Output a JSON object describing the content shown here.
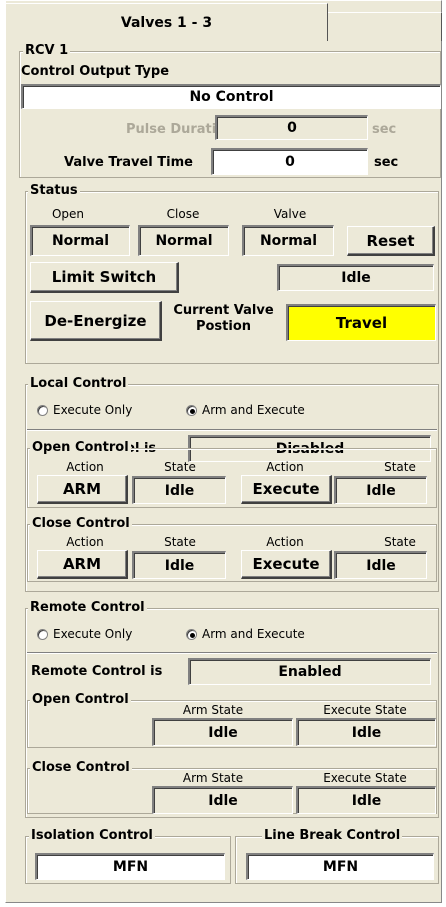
{
  "tabs": {
    "active": "Valves 1 - 3",
    "inactive": ""
  },
  "rcv": {
    "title": "RCV 1",
    "control_output_type_label": "Control Output Type",
    "control_output_type_value": "No Control",
    "pulse_duration_label": "Pulse Duration",
    "pulse_duration_value": "0",
    "pulse_unit": "sec",
    "valve_travel_time_label": "Valve Travel Time",
    "valve_travel_time_value": "0",
    "travel_unit": "sec"
  },
  "status": {
    "title": "Status",
    "open_label": "Open",
    "close_label": "Close",
    "valve_label": "Valve",
    "open_value": "Normal",
    "close_value": "Normal",
    "valve_value": "Normal",
    "reset_button": "Reset",
    "limit_switch_button": "Limit Switch",
    "limit_state": "Idle",
    "deenergize_button": "De-Energize",
    "current_valve_label_line1": "Current Valve",
    "current_valve_label_line2": "Postion",
    "current_valve_value": "Travel",
    "highlight_color": "#ffff00"
  },
  "local": {
    "title": "Local Control",
    "radio_execute_only": "Execute Only",
    "radio_arm_execute": "Arm and Execute",
    "selected": "Arm and Execute",
    "control_is_label": "Local Control is",
    "control_is_value": "Disabled",
    "open": {
      "title": "Open Control",
      "action_label_1": "Action",
      "state_label_1": "State",
      "action_label_2": "Action",
      "state_label_2": "State",
      "arm_button": "ARM",
      "arm_state": "Idle",
      "execute_button": "Execute",
      "execute_state": "Idle"
    },
    "close": {
      "title": "Close Control",
      "action_label_1": "Action",
      "state_label_1": "State",
      "action_label_2": "Action",
      "state_label_2": "State",
      "arm_button": "ARM",
      "arm_state": "Idle",
      "execute_button": "Execute",
      "execute_state": "Idle"
    }
  },
  "remote": {
    "title": "Remote Control",
    "radio_execute_only": "Execute Only",
    "radio_arm_execute": "Arm and Execute",
    "selected": "Arm and Execute",
    "control_is_label": "Remote Control is",
    "control_is_value": "Enabled",
    "open": {
      "title": "Open Control",
      "arm_state_label": "Arm State",
      "arm_state": "Idle",
      "execute_state_label": "Execute State",
      "execute_state": "Idle"
    },
    "close": {
      "title": "Close Control",
      "arm_state_label": "Arm State",
      "arm_state": "Idle",
      "execute_state_label": "Execute State",
      "execute_state": "Idle"
    }
  },
  "isolation": {
    "title": "Isolation Control",
    "value": "MFN"
  },
  "line_break": {
    "title": "Line Break Control",
    "value": "MFN"
  }
}
